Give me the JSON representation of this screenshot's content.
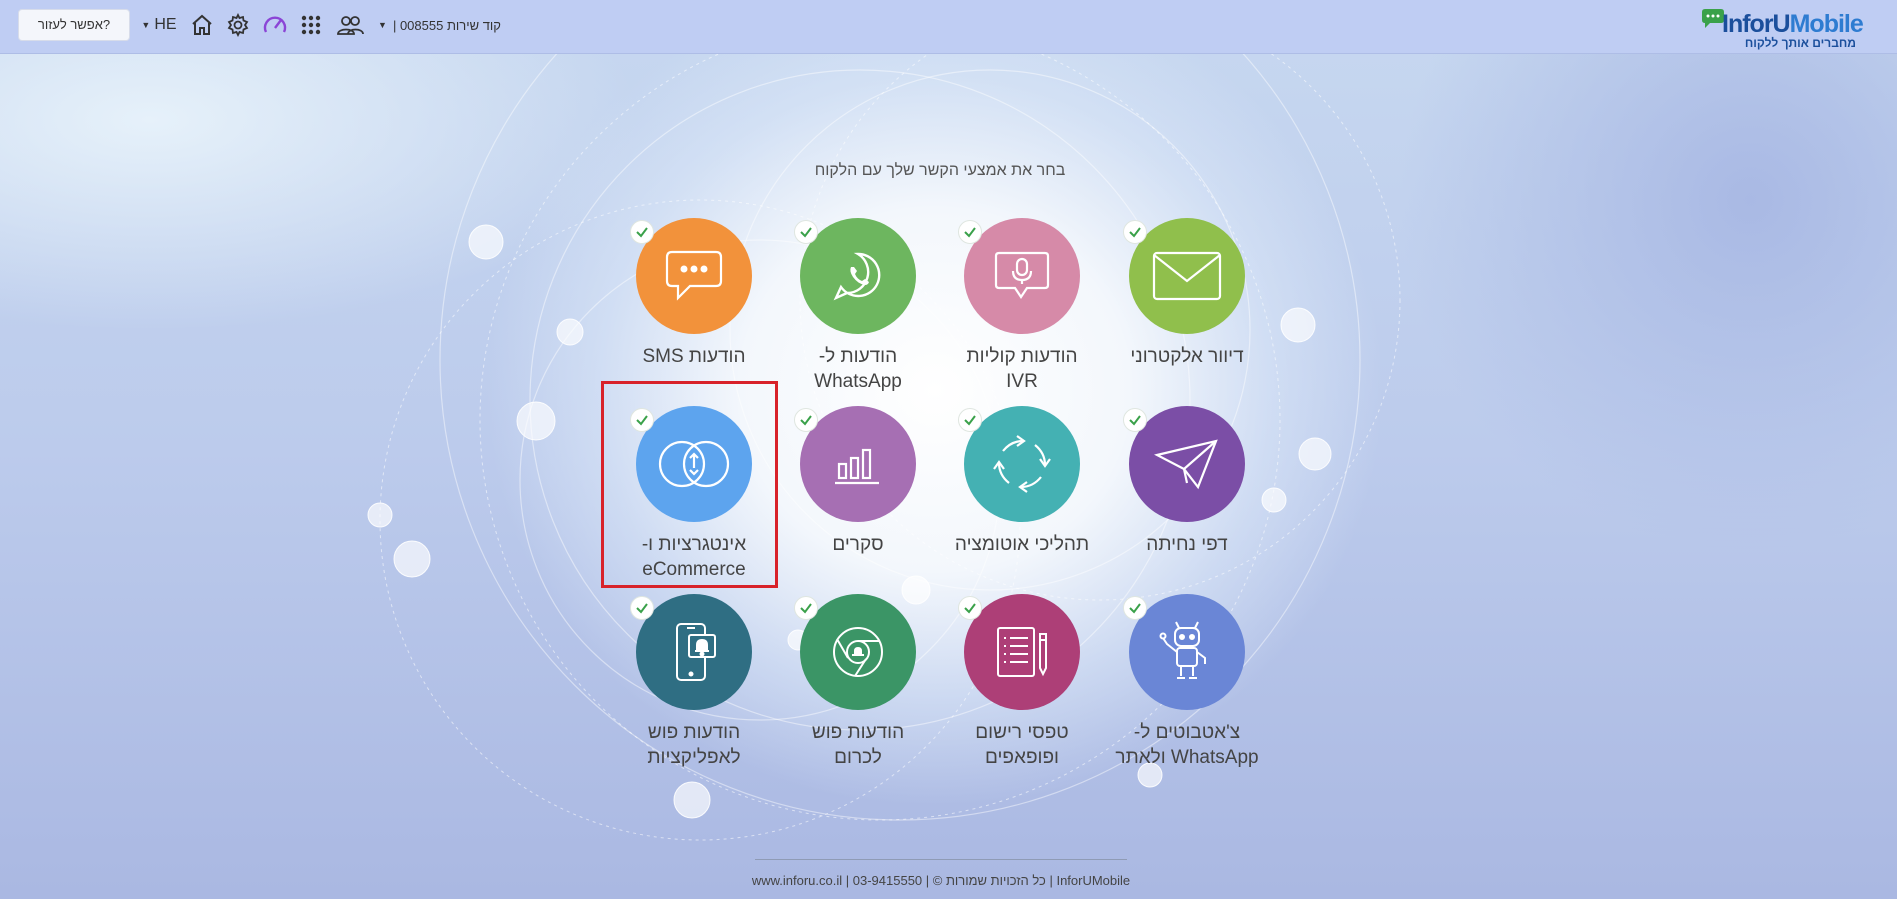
{
  "header": {
    "help_label": "אפשר לעזור?",
    "lang_label": "HE",
    "account_label": "קוד שירות 008555 |",
    "logo_text_a": "InforU",
    "logo_text_b": "Mobile",
    "logo_tagline": "מחברים אותך ללקוח",
    "icons": [
      "chevron-down-icon",
      "home-icon",
      "gear-icon",
      "dashboard-gauge-icon",
      "apps-grid-icon",
      "users-icon"
    ]
  },
  "main": {
    "subtitle": "בחר את אמצעי הקשר שלך עם הלקוח",
    "tiles": [
      {
        "label": "הודעות SMS",
        "color": "#f2923b",
        "icon": "chat-bubble-icon"
      },
      {
        "label": "הודעות ל-\nWhatsApp",
        "color": "#6db65f",
        "icon": "whatsapp-icon"
      },
      {
        "label": "הודעות קוליות\nIVR",
        "color": "#d68aa8",
        "icon": "microphone-icon"
      },
      {
        "label": "דיוור אלקטרוני",
        "color": "#90bf4c",
        "icon": "envelope-icon"
      },
      {
        "label": "אינטגרציות ו-\neCommerce",
        "color": "#5da4ee",
        "icon": "integration-icon"
      },
      {
        "label": "סקרים",
        "color": "#a66fb3",
        "icon": "bar-chart-icon"
      },
      {
        "label": "תהליכי אוטומציה",
        "color": "#44b1b3",
        "icon": "refresh-arrows-icon"
      },
      {
        "label": "דפי נחיתה",
        "color": "#7b4ea6",
        "icon": "paper-plane-icon"
      },
      {
        "label": "הודעות פוש\nלאפליקציות",
        "color": "#2f6e83",
        "icon": "mobile-bell-icon"
      },
      {
        "label": "הודעות פוש\nלכרום",
        "color": "#3b9566",
        "icon": "chrome-bell-icon"
      },
      {
        "label": "טפסי רישום\nופופאפים",
        "color": "#ad3f77",
        "icon": "form-pencil-icon"
      },
      {
        "label": "צ'אטבוטים ל-\nWhatsApp ולאתר",
        "color": "#6a86d6",
        "icon": "robot-icon"
      }
    ]
  },
  "footer": {
    "text": "InforUMobile | כל הזכויות שמורות © | 03-9415550 | www.inforu.co.il"
  },
  "colors": {
    "check": "#3aa14a",
    "highlight": "#d8222a",
    "header_bg": "#bfcdf3"
  }
}
